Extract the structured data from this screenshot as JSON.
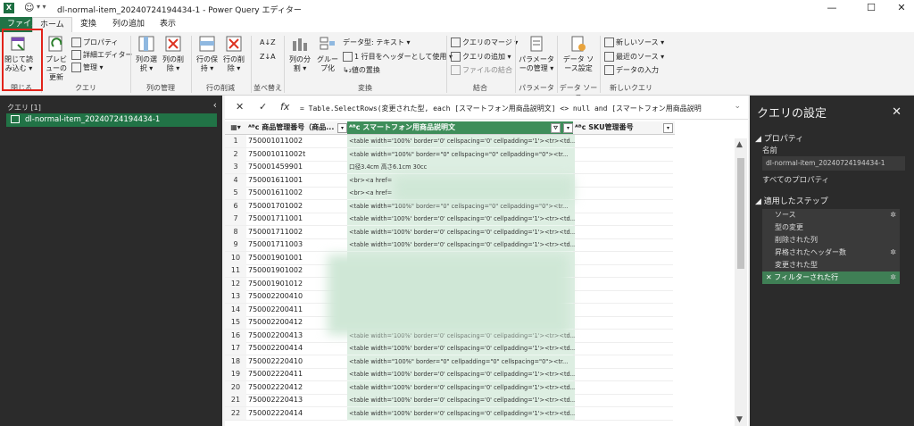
{
  "window": {
    "title": "dl-normal-item_20240724194434-1 - Power Query エディター",
    "minimize": "—",
    "maximize": "☐",
    "close": "✕"
  },
  "tabs": [
    "ファイル",
    "ホーム",
    "変換",
    "列の追加",
    "表示"
  ],
  "ribbon": {
    "close_load": "閉じて読み込む",
    "preview_refresh": "プレビューの更新",
    "properties": "プロパティ",
    "advanced_editor": "詳細エディター",
    "manage": "管理",
    "select_columns": "列の選択",
    "remove_columns": "列の削除",
    "keep_rows": "行の保持",
    "remove_rows": "行の削除",
    "split_column": "列の分割",
    "group_by": "グループ化",
    "data_type": "データ型: テキスト",
    "first_row_header": "1 行目をヘッダーとして使用",
    "replace_values": "値の置換",
    "merge_queries": "クエリのマージ",
    "append_queries": "クエリの追加",
    "combine_files": "ファイルの結合",
    "manage_params": "パラメーターの管理",
    "data_source_settings": "データ ソース設定",
    "new_source": "新しいソース",
    "recent_sources": "最近のソース",
    "enter_data": "データの入力",
    "groups": {
      "close": "閉じる",
      "query": "クエリ",
      "manage_columns": "列の管理",
      "reduce_rows": "行の削減",
      "sort": "並べ替え",
      "transform": "変換",
      "combine": "結合",
      "parameters": "パラメーター",
      "data_sources": "データ ソース",
      "new_query": "新しいクエリ"
    }
  },
  "queries_pane": {
    "header": "クエリ [1]",
    "items": [
      "dl-normal-item_20240724194434-1"
    ]
  },
  "formula": "= Table.SelectRows(変更された型, each [スマートフォン用商品説明文] <> null and [スマートフォン用商品説明",
  "columns": [
    {
      "name": "商品管理番号（商品..."
    },
    {
      "name": "スマートフォン用商品説明文"
    },
    {
      "name": "SKU管理番号"
    }
  ],
  "rows": [
    {
      "n": "1",
      "id": "750001011002",
      "desc": "<table width='100%' border='0' cellspacing='0' cellpadding='1'><tr><td..."
    },
    {
      "n": "2",
      "id": "750001011002t",
      "desc": "<table width=\"100%\" border=\"0\" cellspacing=\"0\" cellpadding=\"0\"><tr..."
    },
    {
      "n": "3",
      "id": "750001459901",
      "desc": "口径3.4cm 高さ6.1cm 30cc"
    },
    {
      "n": "4",
      "id": "750001611001",
      "desc": "<br><a href="
    },
    {
      "n": "5",
      "id": "750001611002",
      "desc": "<br><a href="
    },
    {
      "n": "6",
      "id": "750001701002",
      "desc": "<table width=\"100%\" border=\"0\" cellspacing=\"0\" cellpadding=\"0\"><tr..."
    },
    {
      "n": "7",
      "id": "750001711001",
      "desc": "<table width='100%' border='0' cellspacing='0' cellpadding='1'><tr><td..."
    },
    {
      "n": "8",
      "id": "750001711002",
      "desc": "<table width='100%' border='0' cellspacing='0' cellpadding='1'><tr><td..."
    },
    {
      "n": "9",
      "id": "750001711003",
      "desc": "<table width='100%' border='0' cellspacing='0' cellpadding='1'><tr><td..."
    },
    {
      "n": "10",
      "id": "750001901001",
      "desc": ""
    },
    {
      "n": "11",
      "id": "750001901002",
      "desc": ""
    },
    {
      "n": "12",
      "id": "750001901012",
      "desc": ""
    },
    {
      "n": "13",
      "id": "750002200410",
      "desc": ""
    },
    {
      "n": "14",
      "id": "750002200411",
      "desc": ""
    },
    {
      "n": "15",
      "id": "750002200412",
      "desc": ""
    },
    {
      "n": "16",
      "id": "750002200413",
      "desc": "<table width='100%' border='0' cellspacing='0' cellpadding='1'><tr><td..."
    },
    {
      "n": "17",
      "id": "750002200414",
      "desc": "<table width='100%' border='0' cellspacing='0' cellpadding='1'><tr><td..."
    },
    {
      "n": "18",
      "id": "750002220410",
      "desc": "<table width=\"100%\" border=\"0\" cellpadding=\"0\" cellspacing=\"0\"><tr..."
    },
    {
      "n": "19",
      "id": "750002220411",
      "desc": "<table width='100%' border='0' cellspacing='0' cellpadding='1'><tr><td..."
    },
    {
      "n": "20",
      "id": "750002220412",
      "desc": "<table width='100%' border='0' cellspacing='0' cellpadding='1'><tr><td..."
    },
    {
      "n": "21",
      "id": "750002220413",
      "desc": "<table width='100%' border='0' cellspacing='0' cellpadding='1'><tr><td..."
    },
    {
      "n": "22",
      "id": "750002220414",
      "desc": "<table width='100%' border='0' cellspacing='0' cellpadding='1'><tr><td..."
    }
  ],
  "settings": {
    "title": "クエリの設定",
    "properties_section": "プロパティ",
    "name_label": "名前",
    "name_value": "dl-normal-item_20240724194434-1",
    "all_properties": "すべてのプロパティ",
    "steps_section": "適用したステップ",
    "steps": [
      "ソース",
      "型の変更",
      "削除された列",
      "昇格されたヘッダー数",
      "変更された型",
      "フィルターされた行"
    ]
  }
}
